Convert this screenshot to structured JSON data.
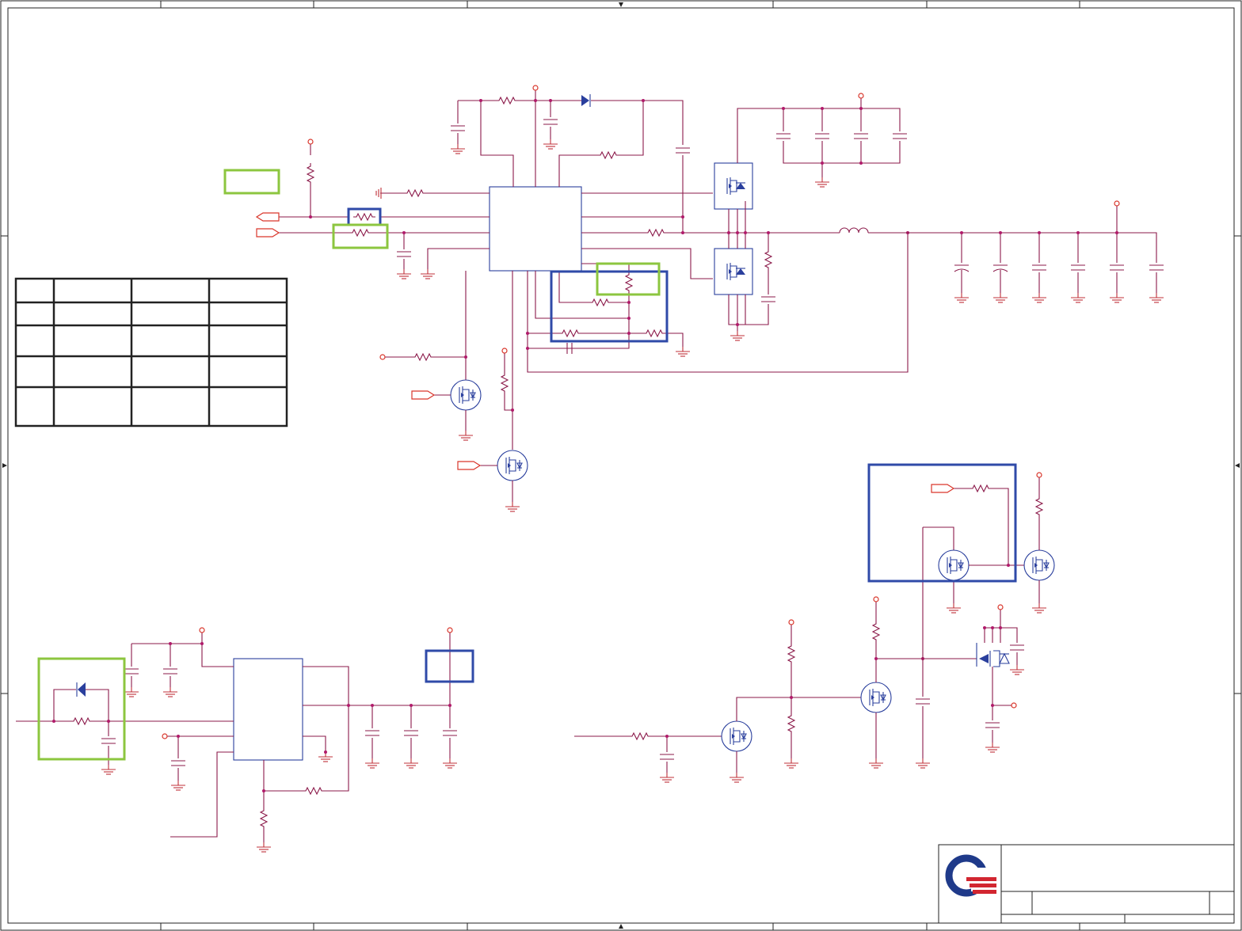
{
  "page": {
    "title": ""
  },
  "colors": {
    "wire": "#8b1a4a",
    "ground": "#c0303a",
    "component": "#2a3f9d",
    "highlight_blue": "#2f4aa8",
    "highlight_green": "#8cc63f",
    "logo_blue": "#1f3a8a",
    "logo_red": "#d22630"
  },
  "icons": [
    "resistor-icon",
    "capacitor-icon",
    "inductor-icon",
    "diode-icon",
    "mosfet-icon",
    "ground-icon",
    "power-pin-icon",
    "port-arrow-icon",
    "company-logo-icon"
  ],
  "title_block": {
    "logo": "company-logo"
  },
  "option_table": {
    "rows": 5,
    "columns": 4
  }
}
